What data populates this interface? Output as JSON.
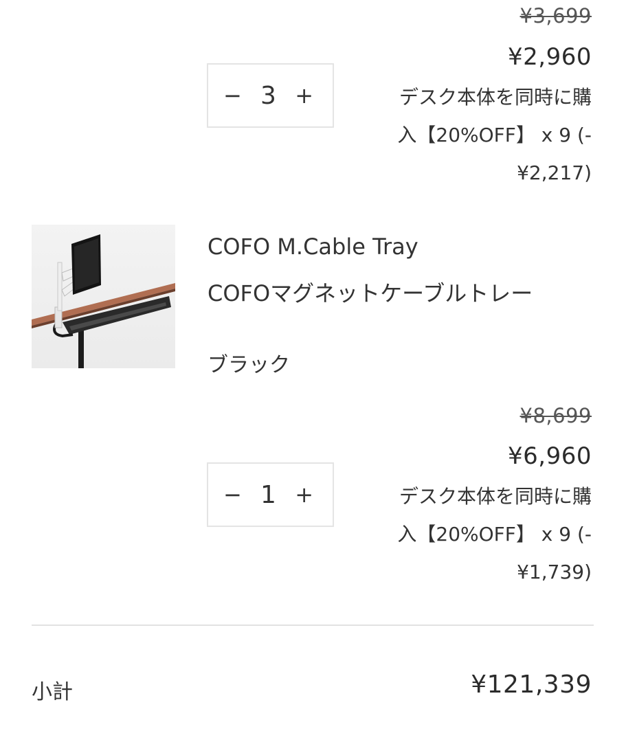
{
  "items": [
    {
      "old_price": "¥3,699",
      "price": "¥2,960",
      "quantity": "3",
      "discount_lines": [
        "デスク本体を同時に購",
        "入【20%OFF】 x 9 (-",
        "¥2,217)"
      ]
    },
    {
      "title_en": "COFO M.Cable Tray",
      "title_ja": "COFOマグネットケーブルトレー",
      "variant": "ブラック",
      "old_price": "¥8,699",
      "price": "¥6,960",
      "quantity": "1",
      "discount_lines": [
        "デスク本体を同時に購",
        "入【20%OFF】 x 9 (-",
        "¥1,739)"
      ]
    }
  ],
  "qty_controls": {
    "minus": "−",
    "plus": "+"
  },
  "subtotal": {
    "label": "小計",
    "value": "¥121,339"
  },
  "image": {
    "icon": "monitor-arm-desk-photo"
  }
}
